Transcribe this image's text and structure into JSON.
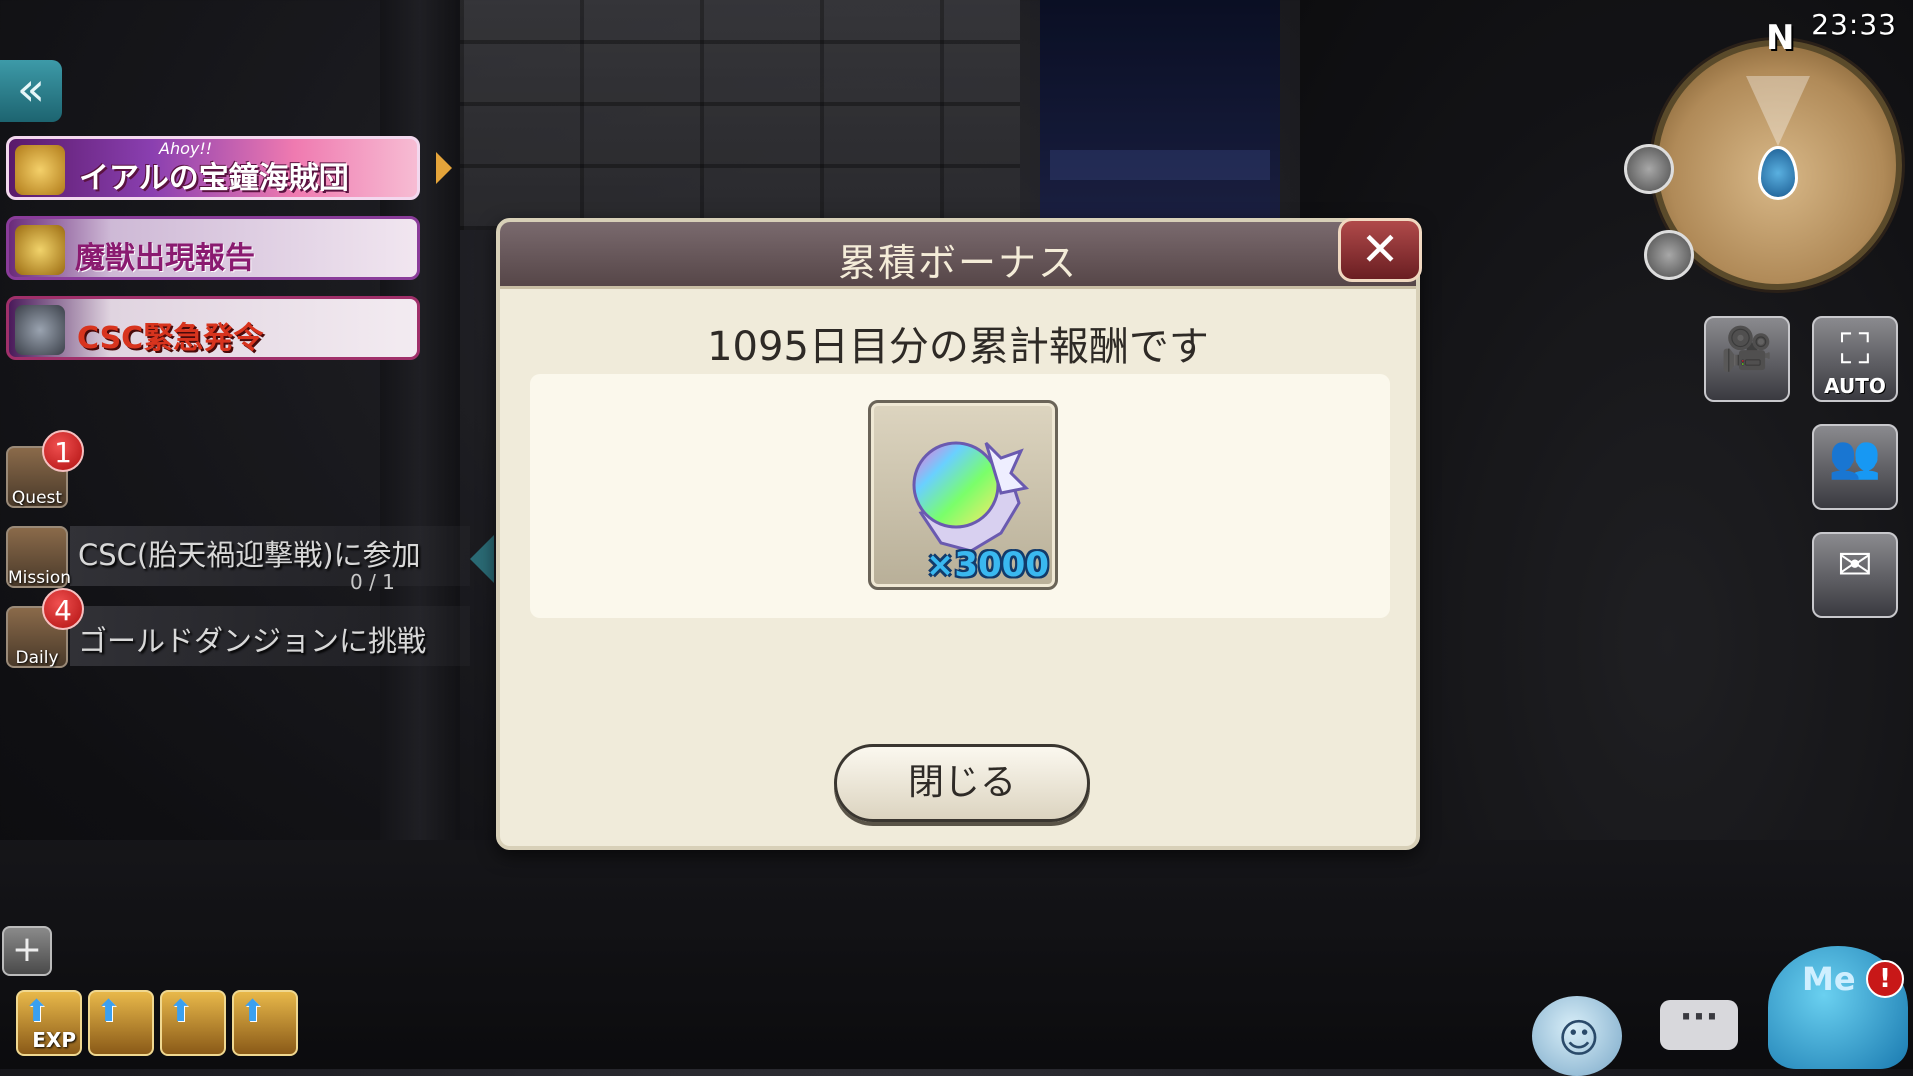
{
  "clock": "23:33",
  "minimap": {
    "north": "N"
  },
  "back_button": {
    "icon": "double-chevron-left-icon",
    "glyph": "«"
  },
  "banners": [
    {
      "label": "イアルの宝鐘海賊団",
      "tag": "Ahoy!!"
    },
    {
      "label": "魔獣出現報告"
    },
    {
      "label": "CSC緊急発令"
    }
  ],
  "quests": {
    "quest": {
      "icon_label": "Quest",
      "badge": "1"
    },
    "mission": {
      "icon_label": "Mission",
      "text": "CSC(胎天禍迎撃戦)に参加",
      "progress": "0 / 1"
    },
    "daily": {
      "icon_label": "Daily",
      "badge": "4",
      "text": "ゴールドダンジョンに挑戦"
    }
  },
  "tools": [
    {
      "name": "exp-boost",
      "label": "EXP"
    },
    {
      "name": "gold-boost",
      "label": ""
    },
    {
      "name": "drop-boost",
      "label": ""
    },
    {
      "name": "shop-boost",
      "label": ""
    }
  ],
  "side_buttons": {
    "camera": {
      "icon": "video-camera-icon"
    },
    "auto": {
      "label": "AUTO"
    },
    "party": {
      "icon": "party-icon"
    },
    "guild_mail": {
      "icon": "guild-mail-icon"
    }
  },
  "bottom_right": {
    "me_label": "Me",
    "me_alert": "!",
    "chat_glyph": "···"
  },
  "dialog": {
    "title": "累積ボーナス",
    "message": "1095日目分の累計報酬です",
    "reward": {
      "icon": "rainbow-crystal-icon",
      "quantity": "×3000"
    },
    "close_button": "閉じる",
    "close_glyph": "✕"
  },
  "colors": {
    "dialog_bg": "#f0ebda",
    "dialog_header": "#564648",
    "quantity_text": "#3ab8f0",
    "close_x_button": "#b04a4a"
  }
}
